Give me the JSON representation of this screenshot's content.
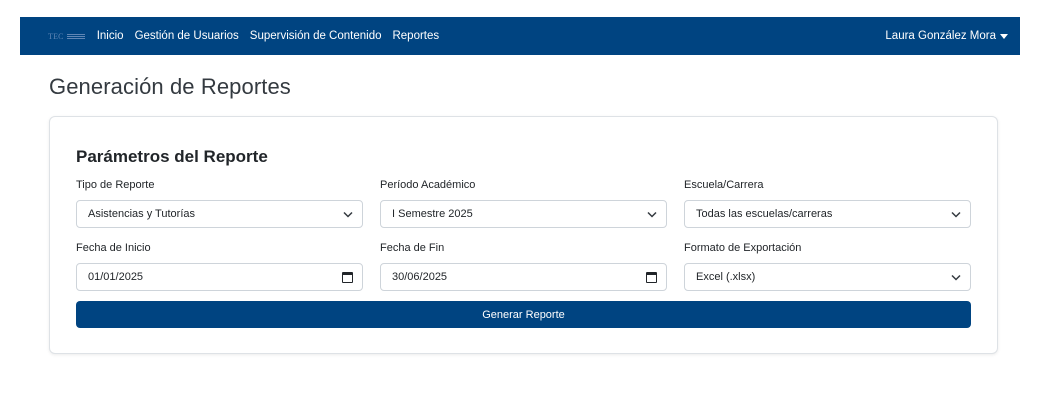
{
  "navbar": {
    "brand": "TEC",
    "links": [
      "Inicio",
      "Gestión de Usuarios",
      "Supervisión de Contenido",
      "Reportes"
    ],
    "user_name": "Laura González Mora"
  },
  "page": {
    "title": "Generación de Reportes"
  },
  "card": {
    "title": "Parámetros del Reporte",
    "fields": {
      "report_type": {
        "label": "Tipo de Reporte",
        "value": "Asistencias y Tutorías"
      },
      "period": {
        "label": "Período Académico",
        "value": "I Semestre 2025"
      },
      "school": {
        "label": "Escuela/Carrera",
        "value": "Todas las escuelas/carreras"
      },
      "start_date": {
        "label": "Fecha de Inicio",
        "value": "01/01/2025"
      },
      "end_date": {
        "label": "Fecha de Fin",
        "value": "30/06/2025"
      },
      "export_format": {
        "label": "Formato de Exportación",
        "value": "Excel (.xlsx)"
      }
    },
    "submit_label": "Generar Reporte"
  },
  "colors": {
    "primary": "#004481",
    "border": "#ced4da"
  },
  "icons": {
    "select": "chevron-down-icon",
    "date": "calendar-icon",
    "user_menu": "caret-down-icon"
  }
}
